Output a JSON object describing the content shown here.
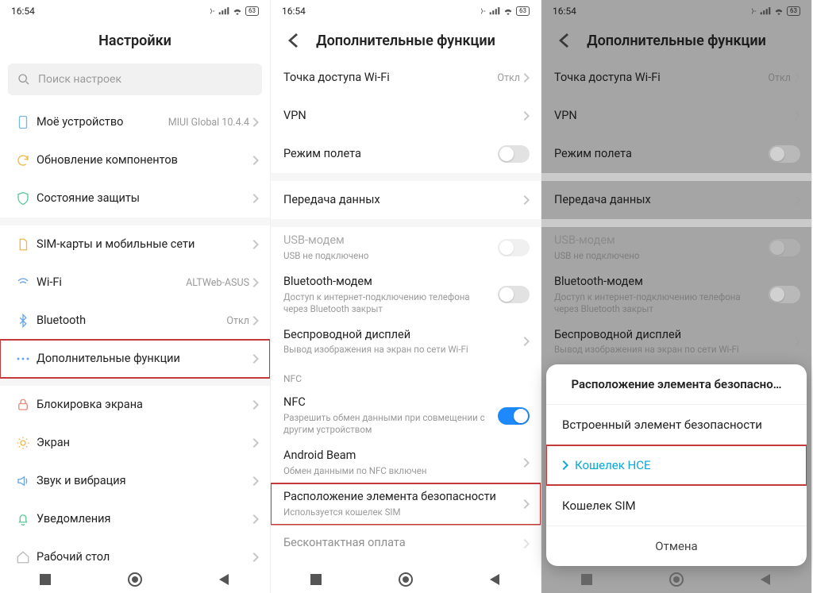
{
  "status": {
    "time": "16:54",
    "battery": "63"
  },
  "screen1": {
    "title": "Настройки",
    "search_placeholder": "Поиск настроек",
    "rows": [
      {
        "label": "Моё устройство",
        "value": "MIUI Global 10.4.4"
      },
      {
        "label": "Обновление компонентов",
        "value": ""
      },
      {
        "label": "Состояние защиты",
        "value": ""
      },
      {
        "label": "SIM-карты и мобильные сети",
        "value": ""
      },
      {
        "label": "Wi-Fi",
        "value": "ALTWeb-ASUS"
      },
      {
        "label": "Bluetooth",
        "value": "Откл"
      },
      {
        "label": "Дополнительные функции",
        "value": ""
      },
      {
        "label": "Блокировка экрана",
        "value": ""
      },
      {
        "label": "Экран",
        "value": ""
      },
      {
        "label": "Звук и вибрация",
        "value": ""
      },
      {
        "label": "Уведомления",
        "value": ""
      },
      {
        "label": "Рабочий стол",
        "value": ""
      }
    ]
  },
  "screen2": {
    "title": "Дополнительные функции",
    "wifi_ap": {
      "label": "Точка доступа Wi-Fi",
      "value": "Откл"
    },
    "vpn": {
      "label": "VPN"
    },
    "airplane": {
      "label": "Режим полета"
    },
    "data": {
      "label": "Передача данных"
    },
    "usb": {
      "label": "USB-модем",
      "sub": "USB не подключено"
    },
    "bt": {
      "label": "Bluetooth-модем",
      "sub": "Доступ к интернет-подключению телефона через Bluetooth закрыт"
    },
    "wd": {
      "label": "Беспроводной дисплей",
      "sub": "Вывод изображения на экран по сети Wi-Fi"
    },
    "nfc_section": "NFC",
    "nfc": {
      "label": "NFC",
      "sub": "Разрешить обмен данными при совмещении с другим устройством"
    },
    "beam": {
      "label": "Android Beam",
      "sub": "Обмен данными по NFC включен"
    },
    "sec": {
      "label": "Расположение элемента безопасности",
      "sub": "Используется кошелек SIM"
    },
    "pay": {
      "label": "Бесконтактная оплата"
    }
  },
  "sheet": {
    "title": "Расположение элемента безопасно…",
    "opt1": "Встроенный элемент безопасности",
    "opt2": "Кошелек HCE",
    "opt3": "Кошелек SIM",
    "cancel": "Отмена"
  }
}
